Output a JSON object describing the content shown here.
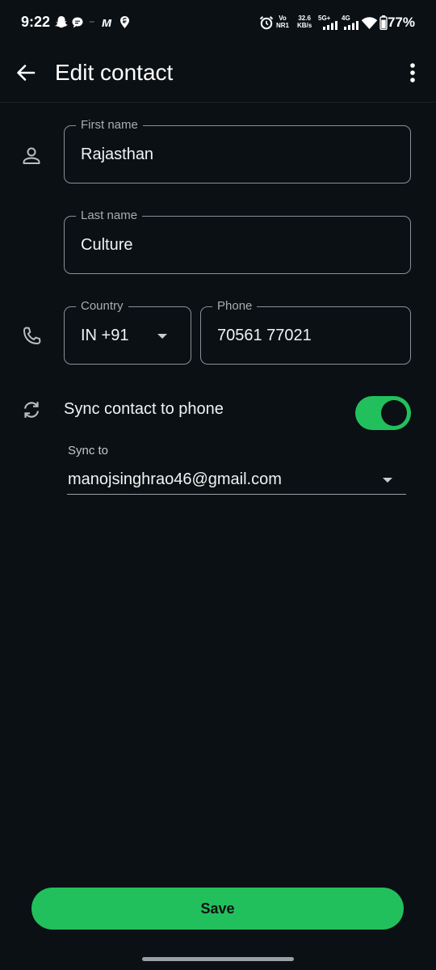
{
  "status_bar": {
    "time": "9:22",
    "vo_top": "Vo",
    "vo_bottom": "NR1",
    "speed_top": "32.6",
    "speed_bottom": "KB/s",
    "net1": "5G+",
    "net2": "4G",
    "battery": "77%"
  },
  "app_bar": {
    "title": "Edit contact"
  },
  "form": {
    "first_name": {
      "label": "First name",
      "value": "Rajasthan"
    },
    "last_name": {
      "label": "Last name",
      "value": "Culture"
    },
    "country": {
      "label": "Country",
      "value": "IN +91"
    },
    "phone": {
      "label": "Phone",
      "value": "70561 77021"
    },
    "sync_contact": {
      "label": "Sync contact to phone",
      "enabled": true
    },
    "sync_to": {
      "label": "Sync to",
      "value": "manojsinghrao46@gmail.com"
    }
  },
  "actions": {
    "save_label": "Save"
  },
  "colors": {
    "background": "#0b1014",
    "accent": "#22c05c",
    "outline": "#8a9096"
  },
  "icons": [
    "snapchat-icon",
    "chat-bubble-icon",
    "m-app-icon",
    "swiggy-icon",
    "alarm-icon",
    "signal-icon",
    "wifi-icon",
    "battery-icon",
    "back-arrow-icon",
    "more-vert-icon",
    "person-icon",
    "phone-icon",
    "sync-icon",
    "dropdown-icon"
  ]
}
